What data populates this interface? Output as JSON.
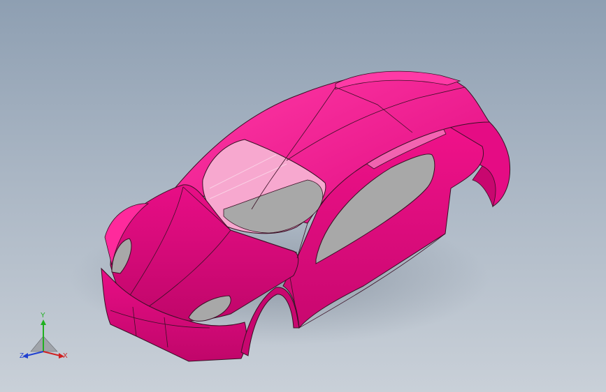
{
  "viewport": {
    "background_top": "#8e9fb2",
    "background_bottom": "#c9d0d8"
  },
  "model": {
    "name": "car-body-shell",
    "body_color": "#f0128a",
    "glass_color": "#f7a8cf",
    "opening_color": "#a8a8a8",
    "edge_color": "#3a1025"
  },
  "triad": {
    "y_label": "Y",
    "z_label": "Z",
    "x_label": "X",
    "y_color": "#20b020",
    "z_color": "#2040d0",
    "x_color": "#d02020"
  }
}
